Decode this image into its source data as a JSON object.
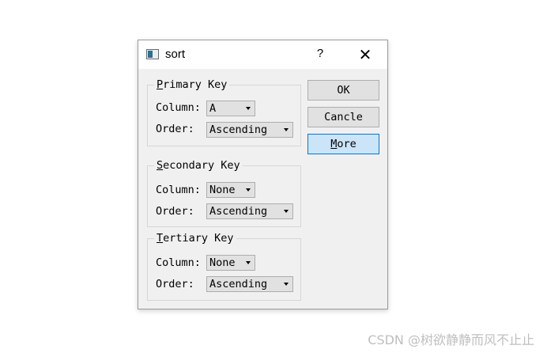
{
  "window": {
    "title": "sort",
    "help_glyph": "?",
    "close_glyph": "✕"
  },
  "groups": [
    {
      "title_mnemonic": "P",
      "title_rest": "rimary Key",
      "column_label": "Column:",
      "column_value": "A",
      "order_label": "Order:",
      "order_value": "Ascending"
    },
    {
      "title_mnemonic": "S",
      "title_rest": "econdary Key",
      "column_label": "Column:",
      "column_value": "None",
      "order_label": "Order:",
      "order_value": "Ascending"
    },
    {
      "title_mnemonic": "T",
      "title_rest": "ertiary Key",
      "column_label": "Column:",
      "column_value": "None",
      "order_label": "Order:",
      "order_value": "Ascending"
    }
  ],
  "buttons": {
    "ok": "OK",
    "cancel": "Cancle",
    "more_mnemonic": "M",
    "more_rest": "ore"
  },
  "watermark": "CSDN @树欲静静而风不止止"
}
